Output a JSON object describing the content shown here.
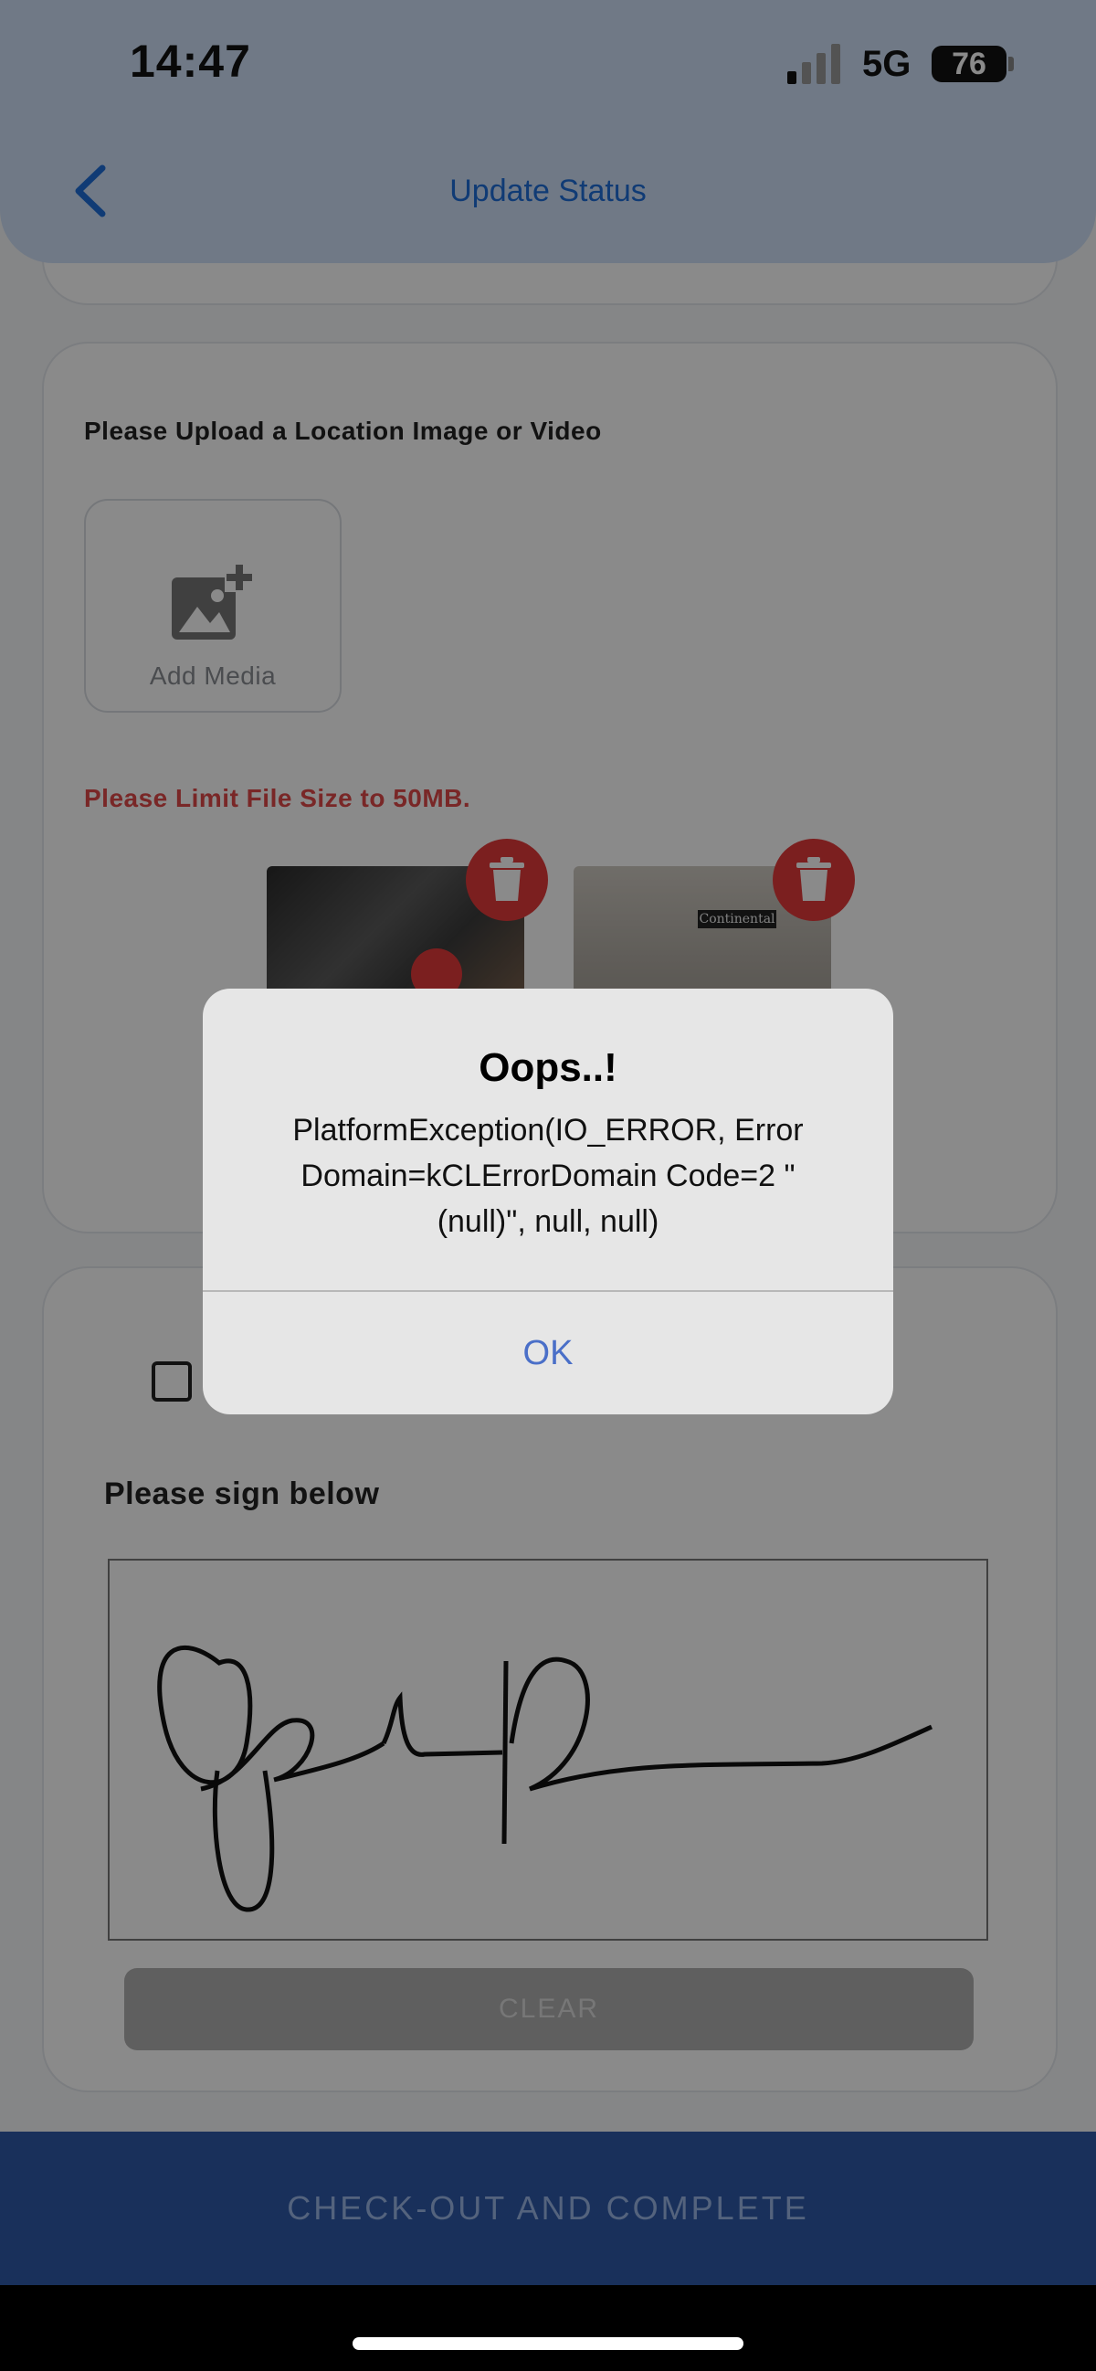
{
  "status_bar": {
    "time": "14:47",
    "network": "5G",
    "battery": "76"
  },
  "header": {
    "title": "Update Status",
    "back_icon": "chevron-left-icon"
  },
  "upload": {
    "title": "Please Upload a Location Image or Video",
    "add_media_label": "Add Media",
    "add_media_icon": "add-photo-icon",
    "limit_text": "Please Limit File Size to 50MB.",
    "thumbnails": [
      {
        "delete_icon": "trash-icon"
      },
      {
        "delete_icon": "trash-icon",
        "brand_text": "Continental"
      }
    ]
  },
  "signature": {
    "label": "Please sign below",
    "clear_label": "CLEAR"
  },
  "footer": {
    "checkout_label": "CHECK-OUT AND COMPLETE"
  },
  "dialog": {
    "title": "Oops..!",
    "message": "PlatformException(IO_ERROR, Error Domain=kCLErrorDomain Code=2 \"(null)\", null, null)",
    "ok_label": "OK"
  },
  "colors": {
    "header_bg": "#cfe0f7",
    "accent": "#1e6ed8",
    "danger": "#e43a3a",
    "checkout_bg": "#2f5aa8"
  }
}
